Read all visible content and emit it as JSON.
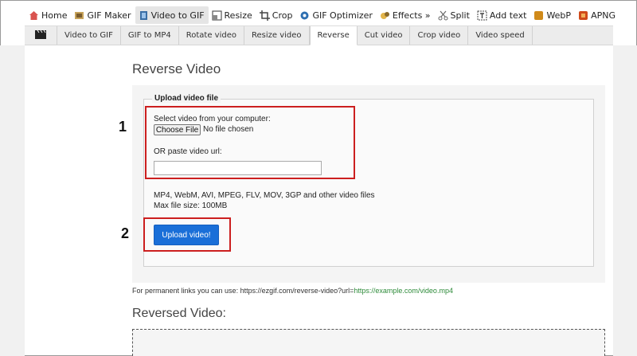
{
  "top_nav": [
    {
      "label": "Home",
      "icon": "home-icon",
      "color": "#d9534f"
    },
    {
      "label": "GIF Maker",
      "icon": "gif-maker-icon",
      "color": "#7a5c2e"
    },
    {
      "label": "Video to GIF",
      "icon": "video-icon",
      "color": "#3a6ea5",
      "active": true
    },
    {
      "label": "Resize",
      "icon": "resize-icon",
      "color": "#555555"
    },
    {
      "label": "Crop",
      "icon": "crop-icon",
      "color": "#444444"
    },
    {
      "label": "GIF Optimizer",
      "icon": "optimizer-icon",
      "color": "#2e6fb0"
    },
    {
      "label": "Effects »",
      "icon": "effects-icon",
      "color": "#8a6a2a"
    },
    {
      "label": "Split",
      "icon": "split-icon",
      "color": "#666666"
    },
    {
      "label": "Add text",
      "icon": "add-text-icon",
      "color": "#444444"
    },
    {
      "label": "WebP",
      "icon": "webp-icon",
      "color": "#d08a1a"
    },
    {
      "label": "APNG",
      "icon": "apng-icon",
      "color": "#d04a1a"
    }
  ],
  "sub_nav": [
    "Video to GIF",
    "GIF to MP4",
    "Rotate video",
    "Resize video",
    "Reverse",
    "Cut video",
    "Crop video",
    "Video speed"
  ],
  "sub_nav_active": "Reverse",
  "page_title": "Reverse Video",
  "upload": {
    "legend": "Upload video file",
    "select_label": "Select video from your computer:",
    "choose_button": "Choose File",
    "no_file": "No file chosen",
    "url_label": "OR paste video url:",
    "url_value": "",
    "formats": "MP4, WebM, AVI, MPEG, FLV, MOV, 3GP and other video files",
    "max_size": "Max file size: 100MB",
    "submit": "Upload video!"
  },
  "annotations": {
    "step1": "1",
    "step2": "2",
    "highlight_color": "#cc1f1f"
  },
  "permalink": {
    "prefix": "For permanent links you can use: https://ezgif.com/reverse-video?url=",
    "example": "https://example.com/video.mp4"
  },
  "reversed_title": "Reversed Video:"
}
